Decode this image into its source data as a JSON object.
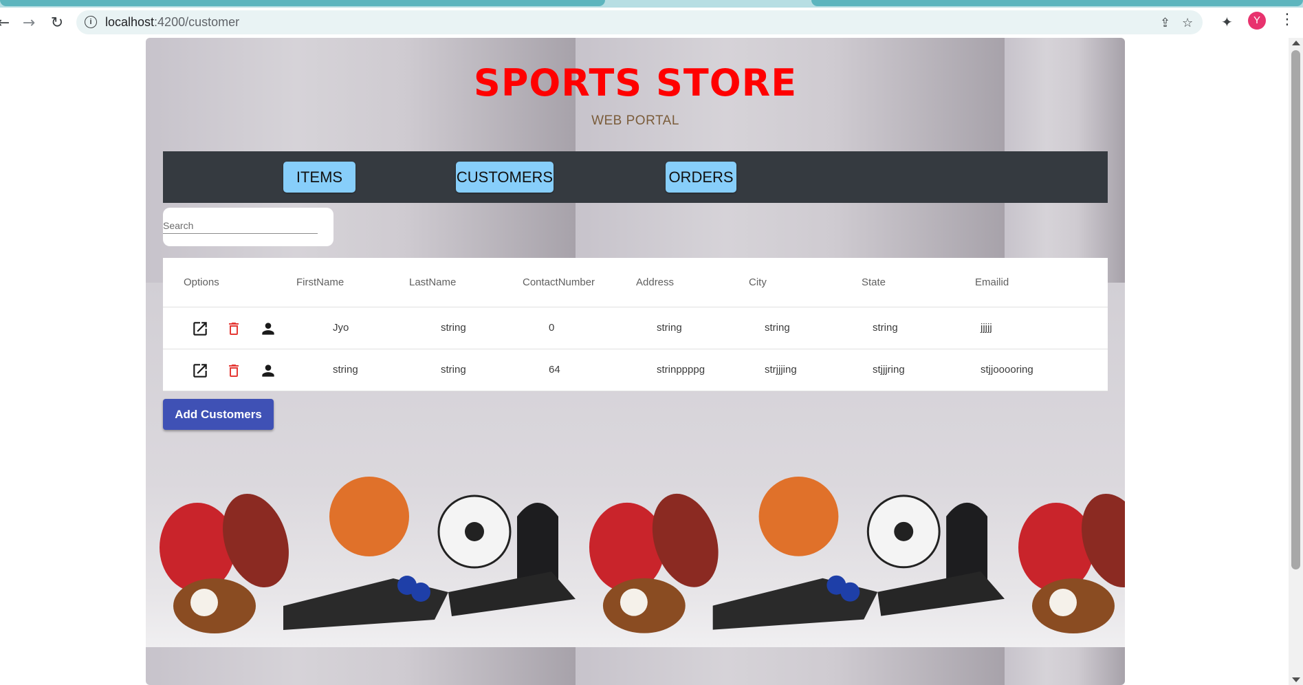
{
  "browser": {
    "url_host": "localhost",
    "url_rest": ":4200/customer",
    "avatar_initial": "Y",
    "icons": [
      "back-icon",
      "forward-icon",
      "reload-icon",
      "info-icon",
      "share-icon",
      "star-icon",
      "extensions-icon",
      "menu-icon"
    ]
  },
  "header": {
    "title": "SPORTS STORE",
    "subtitle": "WEB PORTAL",
    "title_color": "#ff0000"
  },
  "nav": {
    "items": [
      "ITEMS",
      "CUSTOMERS",
      "ORDERS"
    ],
    "bar_color": "#353a40",
    "button_color": "#87cefa"
  },
  "search": {
    "placeholder": "Search",
    "value": ""
  },
  "table": {
    "columns": [
      "Options",
      "FirstName",
      "LastName",
      "ContactNumber",
      "Address",
      "City",
      "State",
      "Emailid"
    ],
    "rows": [
      {
        "first": "Jyo",
        "last": "string",
        "contact": "0",
        "address": "string",
        "city": "string",
        "state": "string",
        "email": "jjjjj"
      },
      {
        "first": "string",
        "last": "string",
        "contact": "64",
        "address": "strinppppg",
        "city": "strjjjing",
        "state": "stjjjring",
        "email": "stjjooooring"
      }
    ],
    "option_icons": [
      "open-in-new-icon",
      "delete-icon",
      "person-icon"
    ],
    "delete_color": "#e53935"
  },
  "actions": {
    "add_label": "Add Customers",
    "add_color": "#3f51b5"
  }
}
